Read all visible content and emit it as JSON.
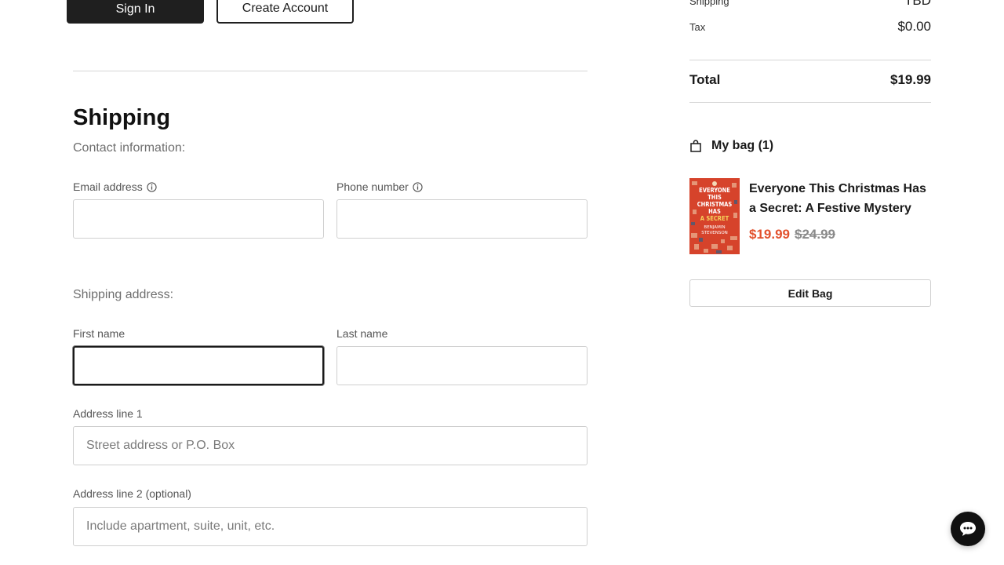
{
  "auth": {
    "sign_in_label": "Sign In",
    "create_account_label": "Create Account"
  },
  "shipping": {
    "title": "Shipping",
    "contact_heading": "Contact information:",
    "email_label": "Email address",
    "email_value": "",
    "phone_label": "Phone number",
    "phone_value": "",
    "address_heading": "Shipping address:",
    "first_name_label": "First name",
    "first_name_value": "",
    "last_name_label": "Last name",
    "last_name_value": "",
    "address1_label": "Address line 1",
    "address1_placeholder": "Street address or P.O. Box",
    "address2_label": "Address line 2 (optional)",
    "address2_placeholder": "Include apartment, suite, unit, etc."
  },
  "summary": {
    "shipping_label": "Shipping",
    "shipping_value": "TBD",
    "tax_label": "Tax",
    "tax_value": "$0.00",
    "total_label": "Total",
    "total_value": "$19.99"
  },
  "bag": {
    "title": "My bag (1)",
    "items": [
      {
        "title": "Everyone This Christmas Has a Secret: A Festive Mystery",
        "price": "$19.99",
        "original_price": "$24.99",
        "cover_text": [
          "EVERYONE",
          "THIS",
          "CHRISTMAS",
          "HAS",
          "A SECRET",
          "BENJAMIN",
          "STEVENSON"
        ]
      }
    ],
    "edit_label": "Edit Bag"
  },
  "colors": {
    "sale_price": "#e2512d",
    "primary_button": "#1f1f1f",
    "book_cover": "#d6432b"
  },
  "icons": {
    "info": "info-icon",
    "bag": "shopping-bag-icon",
    "chat": "chat-icon"
  }
}
